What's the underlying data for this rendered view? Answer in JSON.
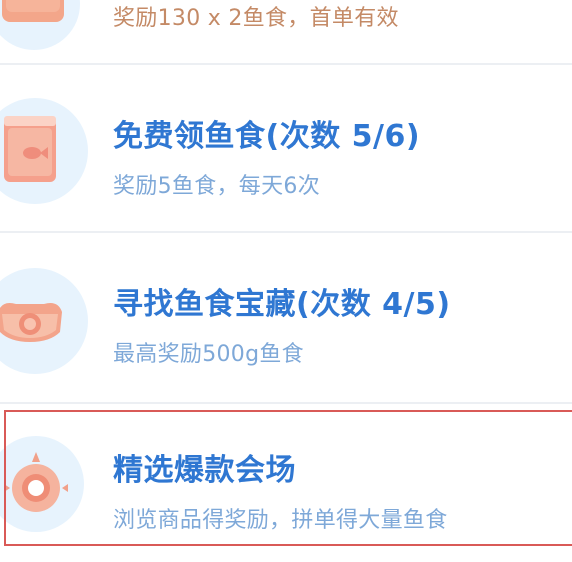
{
  "tasks": [
    {
      "title": "",
      "description": "奖励130 x 2鱼食，首单有效",
      "icon": "order-bonus-icon"
    },
    {
      "title": "免费领鱼食(次数 5/6)",
      "description": "奖励5鱼食，每天6次",
      "icon": "fish-food-bag-icon"
    },
    {
      "title": "寻找鱼食宝藏(次数 4/5)",
      "description": "最高奖励500g鱼食",
      "icon": "treasure-icon"
    },
    {
      "title": "精选爆款会场",
      "description": "浏览商品得奖励，拼单得大量鱼食",
      "icon": "featured-venue-icon"
    }
  ],
  "colors": {
    "title": "#2f77d2",
    "description": "#7ea8d8",
    "highlight_border": "#d95a57",
    "icon_bg": "#e7f3fd",
    "divider": "#eceff3"
  }
}
